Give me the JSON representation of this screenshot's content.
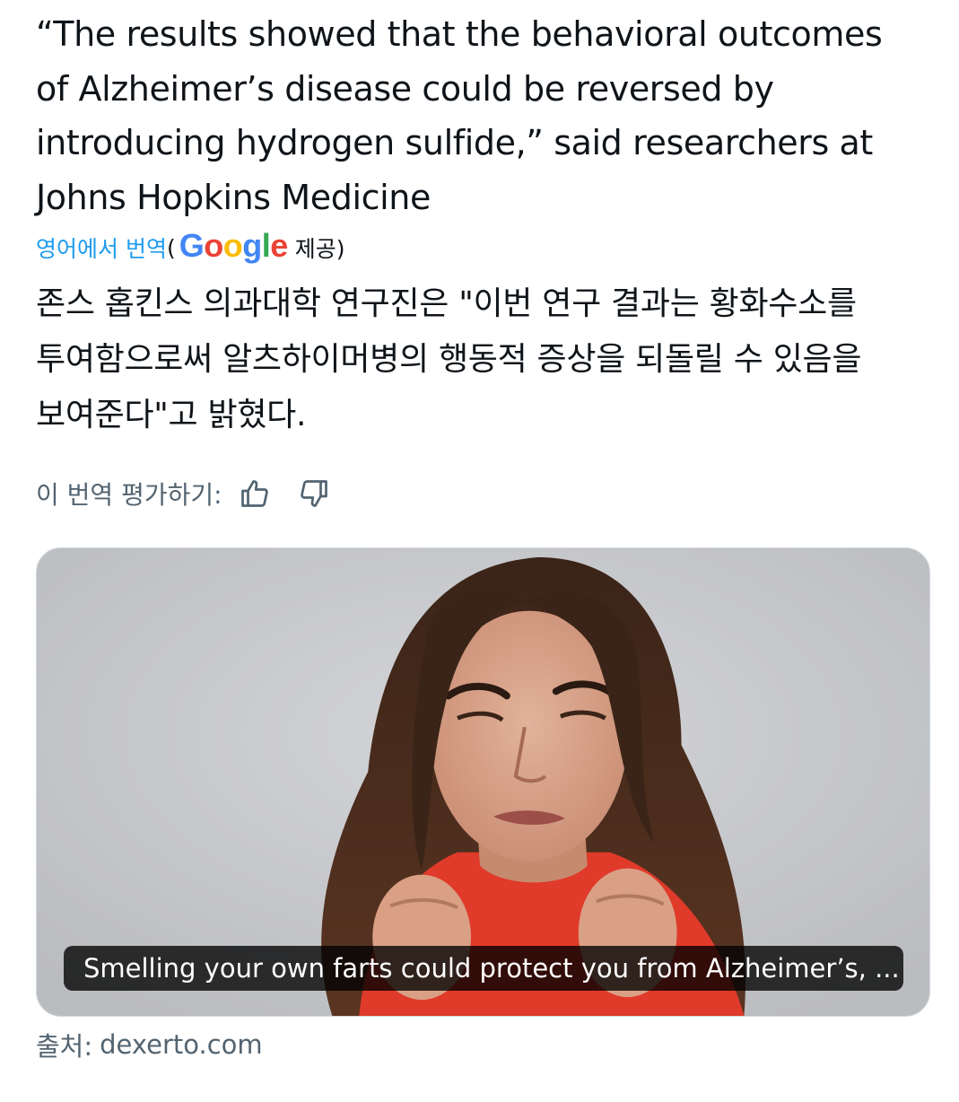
{
  "tweet": {
    "text": "“The results showed that the behavioral outcomes\nof Alzheimer’s disease could be reversed by\nintroducing hydrogen sulfide,” said researchers at\nJohns Hopkins Medicine"
  },
  "translation": {
    "link_label": "영어에서 번역",
    "paren_open": "(",
    "provider": "Google",
    "provider_suffix": "제공)",
    "text": "존스 홉킨스 의과대학 연구진은 \"이번 연구 결과는 황화수소를\n투여함으로써 알츠하이머병의 행동적 증상을 되돌릴 수 있음을\n보여준다\"고 밝혔다.",
    "rate_label": "이 번역 평가하기:",
    "thumbs_up_icon": "thumbs-up-icon",
    "thumbs_down_icon": "thumbs-down-icon"
  },
  "card": {
    "caption": "Smelling your own farts could protect you from Alzheimer’s, ...",
    "source_label": "출처:",
    "source_domain": "dexerto.com"
  },
  "colors": {
    "link": "#1d9bf0",
    "secondary_text": "#536471",
    "primary_text": "#0f1419",
    "card_border": "#cfd9de"
  }
}
